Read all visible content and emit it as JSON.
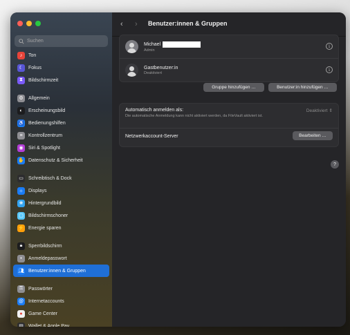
{
  "window": {
    "title": "Benutzer:innen & Gruppen"
  },
  "search": {
    "placeholder": "Suchen"
  },
  "sidebar": {
    "items": [
      {
        "label": "Ton",
        "icon": "sound-icon",
        "color": "#e8443a",
        "glyph": "♪",
        "group_start": false,
        "active": false
      },
      {
        "label": "Fokus",
        "icon": "focus-moon-icon",
        "color": "#5856d6",
        "glyph": "☾",
        "group_start": false,
        "active": false
      },
      {
        "label": "Bildschirmzeit",
        "icon": "screen-time-icon",
        "color": "#7a5af8",
        "glyph": "⧗",
        "group_start": false,
        "active": false
      },
      {
        "label": "Allgemein",
        "icon": "gear-icon",
        "color": "#8e8e93",
        "glyph": "⚙",
        "group_start": true,
        "active": false
      },
      {
        "label": "Erscheinungsbild",
        "icon": "appearance-icon",
        "color": "#1c1c1e",
        "glyph": "◐",
        "group_start": false,
        "active": false
      },
      {
        "label": "Bedienungshilfen",
        "icon": "accessibility-icon",
        "color": "#1a7cf5",
        "glyph": "♿",
        "group_start": false,
        "active": false
      },
      {
        "label": "Kontrollzentrum",
        "icon": "control-center-icon",
        "color": "#8e8e93",
        "glyph": "≡",
        "group_start": false,
        "active": false
      },
      {
        "label": "Siri & Spotlight",
        "icon": "siri-icon",
        "color": "#b33ed6",
        "glyph": "◉",
        "group_start": false,
        "active": false
      },
      {
        "label": "Datenschutz & Sicherheit",
        "icon": "privacy-hand-icon",
        "color": "#1a7cf5",
        "glyph": "✋",
        "group_start": false,
        "active": false
      },
      {
        "label": "Schreibtisch & Dock",
        "icon": "desktop-dock-icon",
        "color": "#2c2c2e",
        "glyph": "▭",
        "group_start": true,
        "active": false
      },
      {
        "label": "Displays",
        "icon": "display-icon",
        "color": "#1a7cf5",
        "glyph": "☼",
        "group_start": false,
        "active": false
      },
      {
        "label": "Hintergrundbild",
        "icon": "wallpaper-icon",
        "color": "#33a3f0",
        "glyph": "❀",
        "group_start": false,
        "active": false
      },
      {
        "label": "Bildschirmschoner",
        "icon": "screensaver-icon",
        "color": "#5ac8fa",
        "glyph": "▢",
        "group_start": false,
        "active": false
      },
      {
        "label": "Energie sparen",
        "icon": "battery-icon",
        "color": "#ff9f0a",
        "glyph": "⚡",
        "group_start": false,
        "active": false
      },
      {
        "label": "Sperrbildschirm",
        "icon": "lock-screen-icon",
        "color": "#1c1c1e",
        "glyph": "🔒︎",
        "group_start": true,
        "active": false
      },
      {
        "label": "Anmeldepasswort",
        "icon": "password-icon",
        "color": "#8e8e93",
        "glyph": "•",
        "group_start": false,
        "active": false
      },
      {
        "label": "Benutzer:innen & Gruppen",
        "icon": "users-groups-icon",
        "color": "#1a7cf5",
        "glyph": "👥︎",
        "group_start": false,
        "active": true
      },
      {
        "label": "Passwörter",
        "icon": "key-icon",
        "color": "#8e8e93",
        "glyph": "⚿",
        "group_start": true,
        "active": false
      },
      {
        "label": "Internetaccounts",
        "icon": "at-icon",
        "color": "#1a7cf5",
        "glyph": "@",
        "group_start": false,
        "active": false
      },
      {
        "label": "Game Center",
        "icon": "game-center-icon",
        "color": "#f2f2f2",
        "glyph": "●",
        "group_start": false,
        "active": false
      },
      {
        "label": "Wallet & Apple Pay",
        "icon": "wallet-icon",
        "color": "#2c2c2e",
        "glyph": "▤",
        "group_start": false,
        "active": false
      }
    ]
  },
  "users": [
    {
      "name": "Michael",
      "role": "Admin"
    },
    {
      "name": "Gastbenutzer:in",
      "role": "Deaktiviert"
    }
  ],
  "buttons": {
    "add_group": "Gruppe hinzufügen …",
    "add_user": "Benutzer:in hinzufügen …",
    "edit": "Bearbeiten …"
  },
  "settings": {
    "auto_login_label": "Automatisch anmelden als:",
    "auto_login_desc": "Die automatische Anmeldung kann nicht aktiviert werden, da FileVault aktiviert ist.",
    "auto_login_value": "Deaktiviert",
    "network_server_label": "Netzwerkaccount-Server"
  }
}
